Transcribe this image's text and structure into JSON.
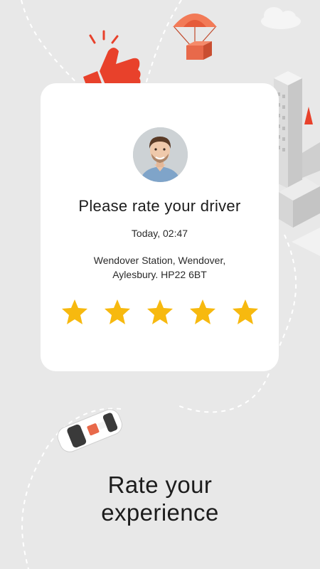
{
  "card": {
    "title": "Please rate your driver",
    "time": "Today, 02:47",
    "address_line1": "Wendover Station, Wendover,",
    "address_line2": "Aylesbury. HP22 6BT"
  },
  "rating": {
    "value": 5,
    "max": 5
  },
  "headline": {
    "line1": "Rate your",
    "line2": "experience"
  },
  "colors": {
    "background": "#e8e8e8",
    "card": "#ffffff",
    "star": "#f7b90f",
    "thumb": "#e8412b",
    "parachute": "#f27a57"
  },
  "icons": [
    "thumbs-up-icon",
    "parachute-icon",
    "cloud-icon",
    "car-icon",
    "star-icon"
  ]
}
